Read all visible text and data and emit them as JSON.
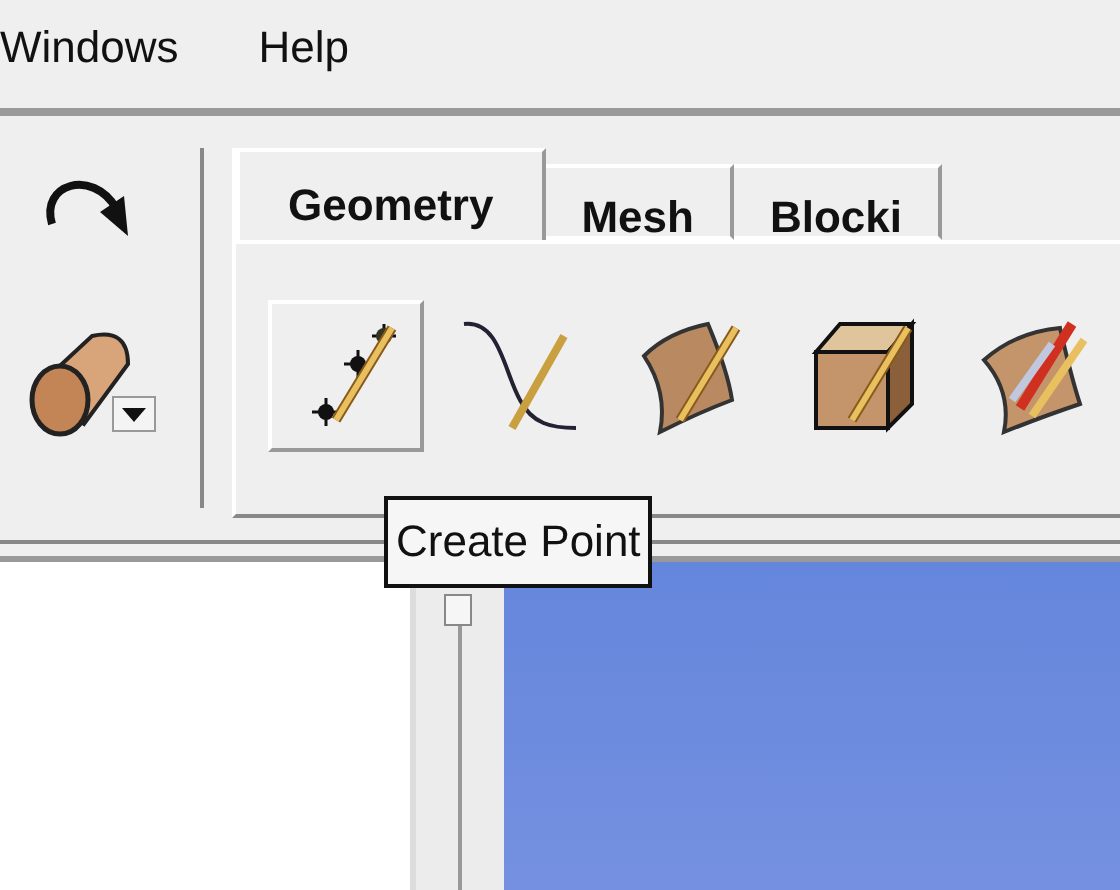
{
  "menu": [
    {
      "label": "Windows"
    },
    {
      "label": "Help"
    }
  ],
  "tabs": [
    {
      "label": "Geometry",
      "selected": true
    },
    {
      "label": "Mesh",
      "selected": false
    },
    {
      "label": "Blocki",
      "selected": false
    }
  ],
  "tools": [
    {
      "kind": "point",
      "hovered": true
    },
    {
      "kind": "curve",
      "hovered": false
    },
    {
      "kind": "surface",
      "hovered": false
    },
    {
      "kind": "body",
      "hovered": false
    },
    {
      "kind": "repair",
      "hovered": false
    }
  ],
  "tooltip": {
    "text": "Create Point"
  }
}
